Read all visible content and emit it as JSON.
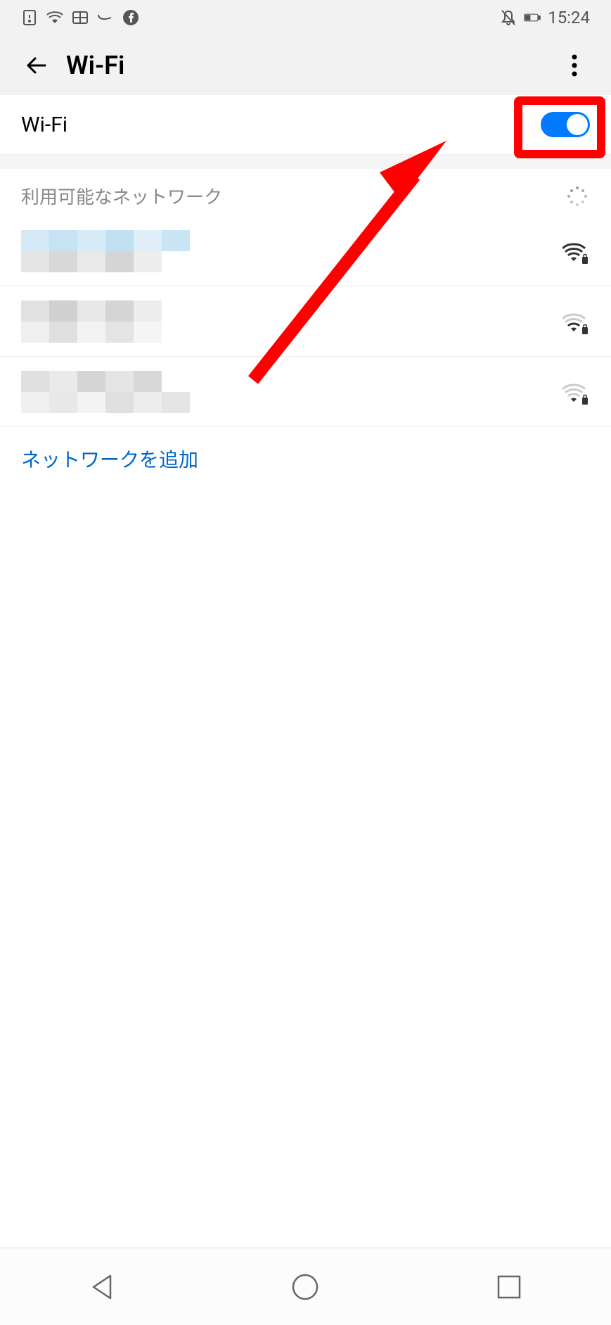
{
  "status_bar": {
    "time": "15:24"
  },
  "header": {
    "title": "Wi-Fi"
  },
  "wifi_toggle": {
    "label": "Wi-Fi",
    "enabled": true
  },
  "section": {
    "title": "利用可能なネットワーク"
  },
  "networks": [
    {
      "signal_strength": "strong",
      "secured": true
    },
    {
      "signal_strength": "medium",
      "secured": true
    },
    {
      "signal_strength": "weak",
      "secured": true
    }
  ],
  "add_network": {
    "label": "ネットワークを追加"
  }
}
